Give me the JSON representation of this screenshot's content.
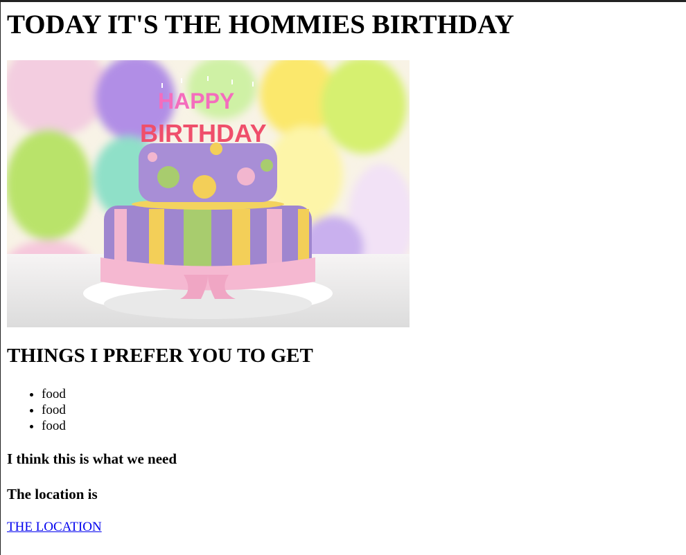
{
  "page": {
    "title": "TODAY IT'S THE HOMMIES BIRTHDAY",
    "subtitle": "THINGS I PREFER YOU TO GET",
    "items": [
      "food",
      "food",
      "food"
    ],
    "need_text": "I think this is what we need",
    "location_heading": "The location is",
    "location_link": "THE LOCATION"
  },
  "image": {
    "description_icon": "birthday-cake-photo",
    "cake_letters_top": "HAPPY",
    "cake_letters_bottom": "BIRTHDAY"
  },
  "colors": {
    "link": "#0000ee",
    "cake_purple": "#9f86cf",
    "cake_pink": "#f2b6cf",
    "cake_yellow": "#f3cf58",
    "cake_green": "#a8cc6e"
  }
}
